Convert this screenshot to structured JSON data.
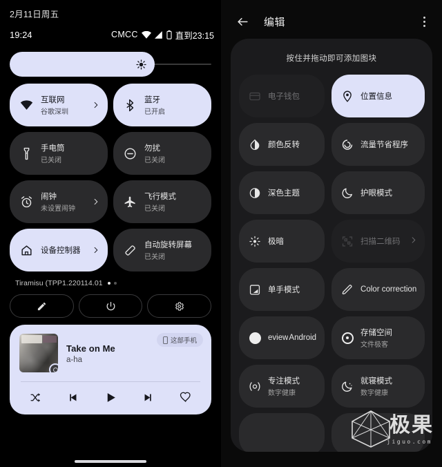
{
  "left_panel": {
    "date": "2月11日周五",
    "statusbar": {
      "clock": "19:24",
      "carrier": "CMCC",
      "battery_until": "直到23:15"
    },
    "brightness": {
      "level_percent": 72
    },
    "tiles": [
      {
        "title": "互联网",
        "subtitle": "谷歌深圳",
        "icon": "wifi-icon",
        "active": true,
        "chevron": true
      },
      {
        "title": "蓝牙",
        "subtitle": "已开启",
        "icon": "bluetooth-icon",
        "active": true,
        "chevron": false
      },
      {
        "title": "手电筒",
        "subtitle": "已关闭",
        "icon": "flashlight-icon",
        "active": false,
        "chevron": false
      },
      {
        "title": "勿扰",
        "subtitle": "已关闭",
        "icon": "do-not-disturb-icon",
        "active": false,
        "chevron": false
      },
      {
        "title": "闹钟",
        "subtitle": "未设置闹钟",
        "icon": "alarm-icon",
        "active": false,
        "chevron": true
      },
      {
        "title": "飞行模式",
        "subtitle": "已关闭",
        "icon": "airplane-icon",
        "active": false,
        "chevron": false
      },
      {
        "title": "设备控制器",
        "subtitle": "",
        "icon": "home-icon",
        "active": true,
        "chevron": true
      },
      {
        "title": "自动旋转屏幕",
        "subtitle": "已关闭",
        "icon": "auto-rotate-icon",
        "active": false,
        "chevron": false
      }
    ],
    "build": {
      "text": "Tiramisu (TPP1.220114.01",
      "page_dots": 2,
      "active_dot": 0
    },
    "footer_buttons": [
      {
        "name": "edit-button",
        "icon": "pencil-icon"
      },
      {
        "name": "power-button",
        "icon": "power-icon"
      },
      {
        "name": "settings-button",
        "icon": "gear-icon"
      }
    ],
    "media": {
      "title": "Take on Me",
      "artist": "a-ha",
      "device_chip": "这部手机",
      "device_chip_icon": "phone-icon",
      "controls": [
        "shuffle-icon",
        "previous-icon",
        "play-icon",
        "next-icon",
        "favorite-icon"
      ]
    }
  },
  "right_panel": {
    "header": {
      "title": "编辑",
      "back_icon": "arrow-back-icon",
      "menu_icon": "overflow-menu-icon"
    },
    "hint": "按住并拖动即可添加图块",
    "tiles": [
      {
        "title": "电子钱包",
        "subtitle": "",
        "icon": "wallet-icon",
        "state": "dim",
        "chevron": false
      },
      {
        "title": "位置信息",
        "subtitle": "",
        "icon": "location-pin-icon",
        "state": "on",
        "chevron": false
      },
      {
        "title": "颜色反转",
        "subtitle": "",
        "icon": "invert-colors-icon",
        "state": "normal",
        "chevron": false
      },
      {
        "title": "流量节省程序",
        "subtitle": "",
        "icon": "data-saver-icon",
        "state": "normal",
        "chevron": false
      },
      {
        "title": "深色主题",
        "subtitle": "",
        "icon": "dark-theme-icon",
        "state": "normal",
        "chevron": false
      },
      {
        "title": "护眼模式",
        "subtitle": "",
        "icon": "night-light-icon",
        "state": "normal",
        "chevron": false
      },
      {
        "title": "极暗",
        "subtitle": "",
        "icon": "extra-dim-icon",
        "state": "normal",
        "chevron": false
      },
      {
        "title": "扫描二维码",
        "subtitle": "",
        "icon": "qr-scan-icon",
        "state": "dim",
        "chevron": true
      },
      {
        "title": "单手模式",
        "subtitle": "",
        "icon": "one-handed-icon",
        "state": "normal",
        "chevron": false
      },
      {
        "title": "Color correction",
        "subtitle": "",
        "icon": "color-correction-icon",
        "state": "normal",
        "chevron": false
      }
    ],
    "split_tiles": [
      {
        "left": "eview",
        "right": "Android",
        "icon": "circle-filled-icon"
      },
      {
        "title": "存储空间",
        "subtitle": "文件极客",
        "icon": "storage-icon"
      }
    ],
    "bottom_tiles": [
      {
        "title": "专注模式",
        "subtitle": "数字健康",
        "icon": "focus-mode-icon"
      },
      {
        "title": "就寝模式",
        "subtitle": "数字健康",
        "icon": "bedtime-icon"
      }
    ],
    "watermark": {
      "logo": "极果",
      "url": "jiguo.com"
    }
  }
}
